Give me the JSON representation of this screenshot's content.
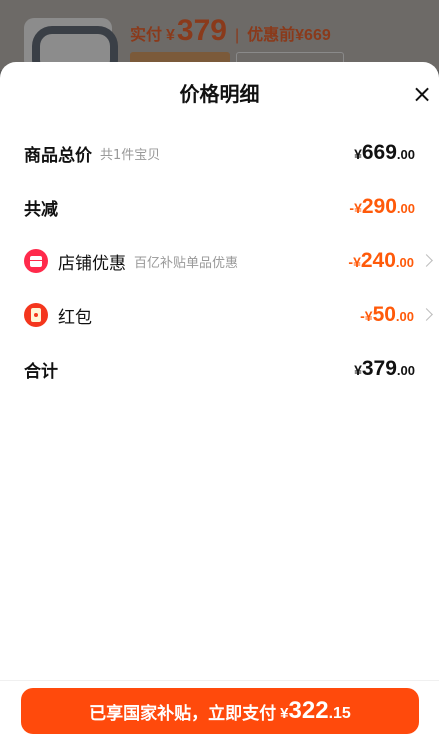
{
  "background": {
    "product_price_label": "实付",
    "currency": "¥",
    "product_price": "379",
    "separator": "|",
    "original_price": "优惠前¥669"
  },
  "sheet": {
    "title": "价格明细",
    "close_label": "×"
  },
  "rows": {
    "total": {
      "label": "商品总价",
      "sub": "共1件宝贝",
      "yen": "¥",
      "int": "669",
      "dec": ".00"
    },
    "reduction": {
      "label": "共减",
      "yen": "-¥",
      "int": "290",
      "dec": ".00"
    },
    "shop_discount": {
      "icon": "shop-icon",
      "label": "店铺优惠",
      "sub": "百亿补贴单品优惠",
      "yen": "-¥",
      "int": "240",
      "dec": ".00"
    },
    "red_packet": {
      "icon": "red-packet-icon",
      "label": "红包",
      "yen": "-¥",
      "int": "50",
      "dec": ".00"
    },
    "sum": {
      "label": "合计",
      "yen": "¥",
      "int": "379",
      "dec": ".00"
    }
  },
  "footer": {
    "pay_text": "已享国家补贴，立即支付",
    "yen": "¥",
    "int": "322",
    "dec": ".15"
  },
  "colors": {
    "accent": "#ff5a0a",
    "button": "#ff4a0c",
    "icon_red": "#ff2a4b"
  }
}
